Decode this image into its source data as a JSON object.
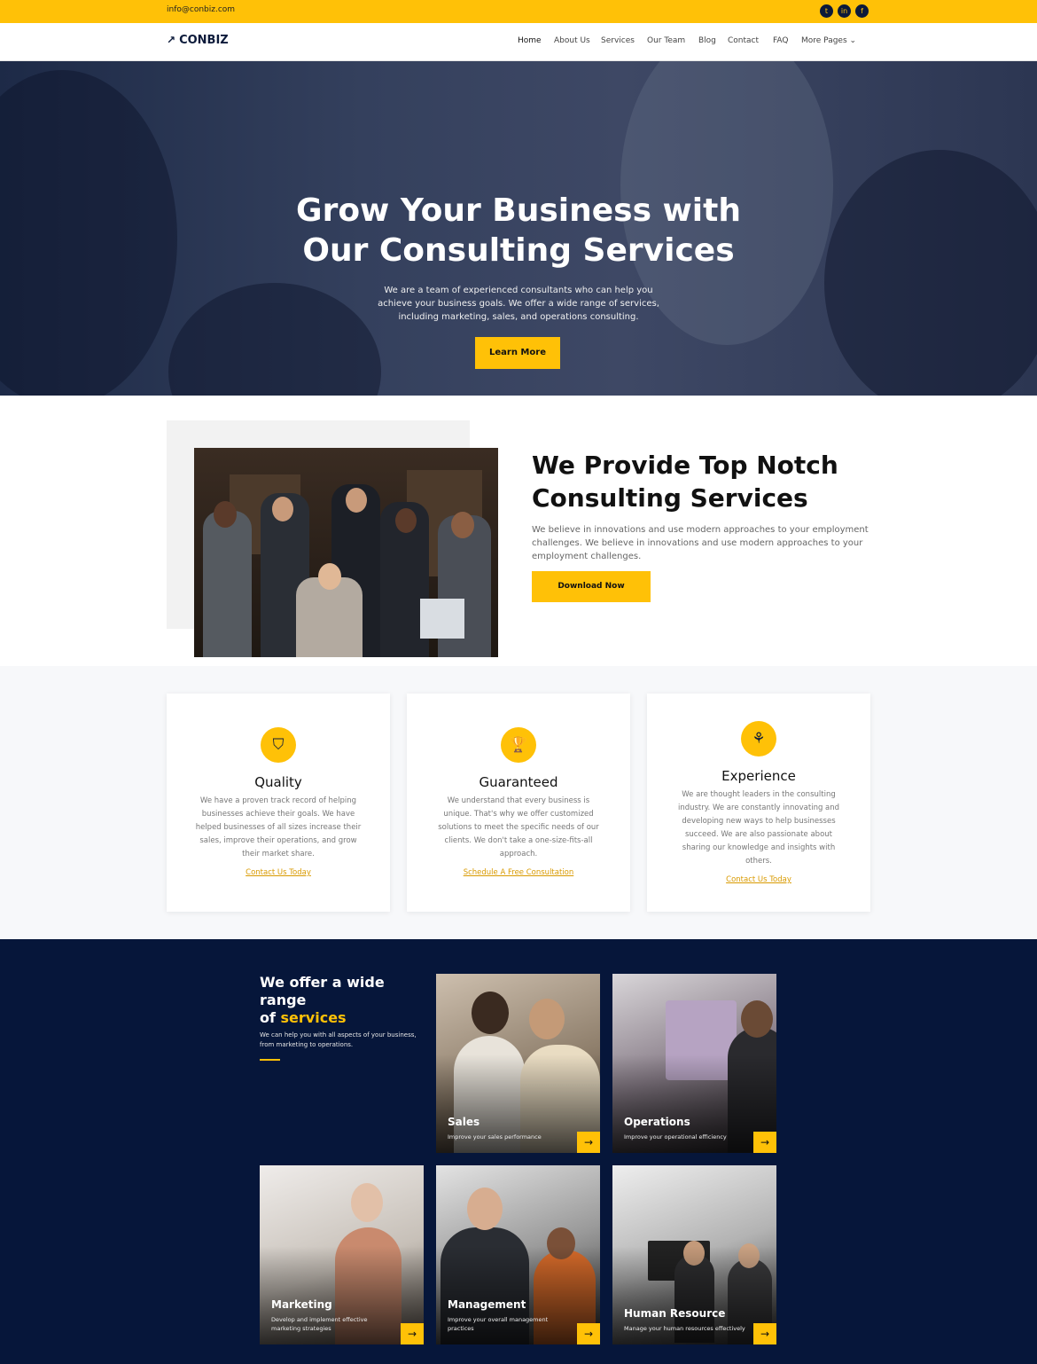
{
  "topbar": {
    "email": "info@conbiz.com",
    "social": [
      "twitter-icon",
      "linkedin-icon",
      "facebook-icon"
    ]
  },
  "nav": {
    "logo_icon": "↗",
    "logo": "CONBIZ",
    "items": [
      "Home",
      "About Us",
      "Services",
      "Our Team",
      "Blog",
      "Contact",
      "FAQ",
      "More Pages"
    ],
    "more_icon": "⌄"
  },
  "hero": {
    "title_line1": "Grow Your Business with",
    "title_line2": "Our Consulting Services",
    "body_line1": "We are a team of experienced consultants who can help you",
    "body_line2": "achieve your business goals. We offer a wide range of services,",
    "body_line3": "including marketing, sales, and operations consulting.",
    "cta": "Learn More"
  },
  "about": {
    "title_line1": "We Provide Top Notch",
    "title_line2": "Consulting Services",
    "body": "We believe in innovations and use modern approaches to your employment challenges. We believe in innovations and use modern approaches to your employment challenges.",
    "cta": "Download Now"
  },
  "features": [
    {
      "icon": "shield-icon",
      "glyph": "⛉",
      "title": "Quality",
      "body": "We have a proven track record of helping businesses achieve their goals. We have helped businesses of all sizes increase their sales, improve their operations, and grow their market share.",
      "link": "Contact Us Today"
    },
    {
      "icon": "trophy-icon",
      "glyph": "🏆",
      "title": "Guaranteed",
      "body": "We understand that every business is unique. That's why we offer customized solutions to meet the specific needs of our clients. We don't take a one-size-fits-all approach.",
      "link": "Schedule A Free Consultation"
    },
    {
      "icon": "plant-icon",
      "glyph": "⚘",
      "title": "Experience",
      "body": "We are thought leaders in the consulting industry. We are constantly innovating and developing new ways to help businesses succeed. We are also passionate about sharing our knowledge and insights with others.",
      "link": "Contact Us Today"
    }
  ],
  "services": {
    "title_part1": "We offer a wide range",
    "title_part2": "of ",
    "title_highlight": "services",
    "subtitle": "We can help you with all aspects of your business, from marketing to operations.",
    "arrow": "→",
    "items": [
      {
        "title": "Sales",
        "desc": "Improve your sales performance"
      },
      {
        "title": "Operations",
        "desc": "Improve your operational efficiency"
      },
      {
        "title": "Marketing",
        "desc": "Develop and implement effective marketing strategies"
      },
      {
        "title": "Management",
        "desc": "Improve your overall management practices"
      },
      {
        "title": "Human Resource",
        "desc": "Manage your human resources effectively"
      }
    ]
  }
}
